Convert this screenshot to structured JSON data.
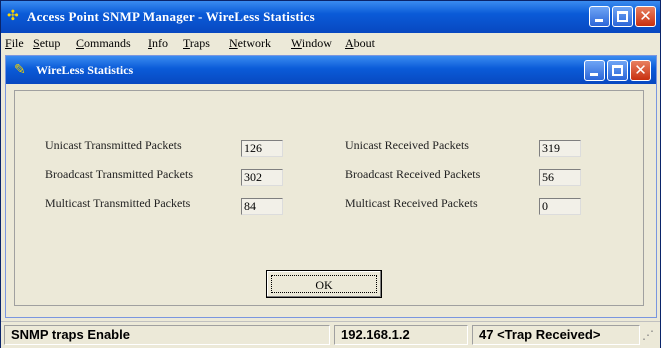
{
  "window": {
    "title": "Access Point SNMP Manager -  WireLess Statistics",
    "title_icon": "network-icon"
  },
  "menu": {
    "items": [
      {
        "first": "F",
        "rest": "ile"
      },
      {
        "first": "S",
        "rest": "etup"
      },
      {
        "first": "C",
        "rest": "ommands"
      },
      {
        "first": "I",
        "rest": "nfo"
      },
      {
        "first": "T",
        "rest": "raps"
      },
      {
        "first": "N",
        "rest": "etwork"
      },
      {
        "first": "W",
        "rest": "indow"
      },
      {
        "first": "A",
        "rest": "bout"
      }
    ]
  },
  "dialog": {
    "title": "WireLess Statistics",
    "title_icon": "pencil-icon",
    "stats": {
      "unicast_tx_label": "Unicast Transmitted Packets",
      "unicast_tx_value": "126",
      "broadcast_tx_label": "Broadcast Transmitted Packets",
      "broadcast_tx_value": "302",
      "multicast_tx_label": "Multicast Transmitted Packets",
      "multicast_tx_value": "84",
      "unicast_rx_label": "Unicast Received Packets",
      "unicast_rx_value": "319",
      "broadcast_rx_label": "Broadcast Received Packets",
      "broadcast_rx_value": "56",
      "multicast_rx_label": "Multicast Received Packets",
      "multicast_rx_value": "0"
    },
    "ok_label": "OK"
  },
  "status": {
    "traps": "SNMP traps Enable",
    "ip": "192.168.1.2",
    "received": "47 <Trap Received>"
  },
  "colors": {
    "titlebar": "#0a5bd8",
    "close_button": "#c83010",
    "window_bg": "#ece9d8"
  }
}
